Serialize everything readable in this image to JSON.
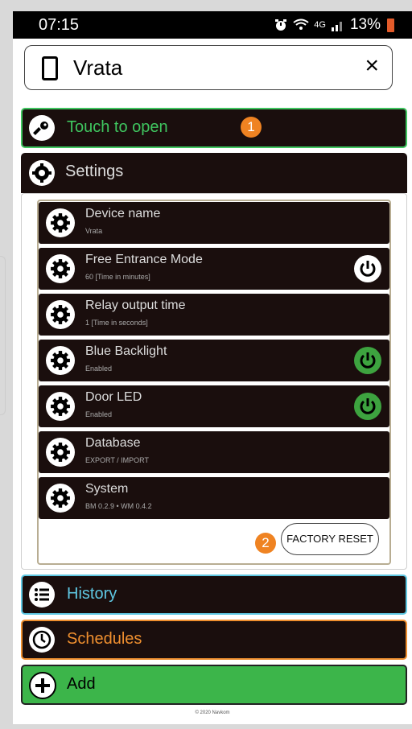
{
  "status_bar": {
    "time": "07:15",
    "icons": "alarm-icon wifi-icon 4g-icon signal-icon",
    "net": "4G",
    "battery": "13%"
  },
  "header": {
    "title": "Vrata",
    "close_label": "×"
  },
  "touch_to_open": {
    "label": "Touch to open",
    "color": "#3fc55f"
  },
  "settings": {
    "label": "Settings",
    "items": [
      {
        "title": "Device name",
        "subtitle": "Vrata"
      },
      {
        "title": "Free Entrance Mode",
        "subtitle": "60 [Time in minutes]",
        "power": "off"
      },
      {
        "title": "Relay output time",
        "subtitle": "1 [Time in seconds]"
      },
      {
        "title": "Blue Backlight",
        "subtitle": "Enabled",
        "power": "on"
      },
      {
        "title": "Door LED",
        "subtitle": "Enabled",
        "power": "on"
      },
      {
        "title": "Database",
        "subtitle": "EXPORT / IMPORT"
      },
      {
        "title": "System",
        "subtitle": "BM 0.2.9 • WM 0.4.2"
      }
    ],
    "factory_reset_label": "FACTORY RESET"
  },
  "history": {
    "label": "History",
    "color": "#5fc8e3"
  },
  "schedules": {
    "label": "Schedules",
    "color": "#ef8f2f"
  },
  "add": {
    "label": "Add",
    "color": "#3cb54a"
  },
  "markers": [
    "1",
    "2"
  ],
  "footer": {
    "copyright": "© 2020 Navkom"
  }
}
